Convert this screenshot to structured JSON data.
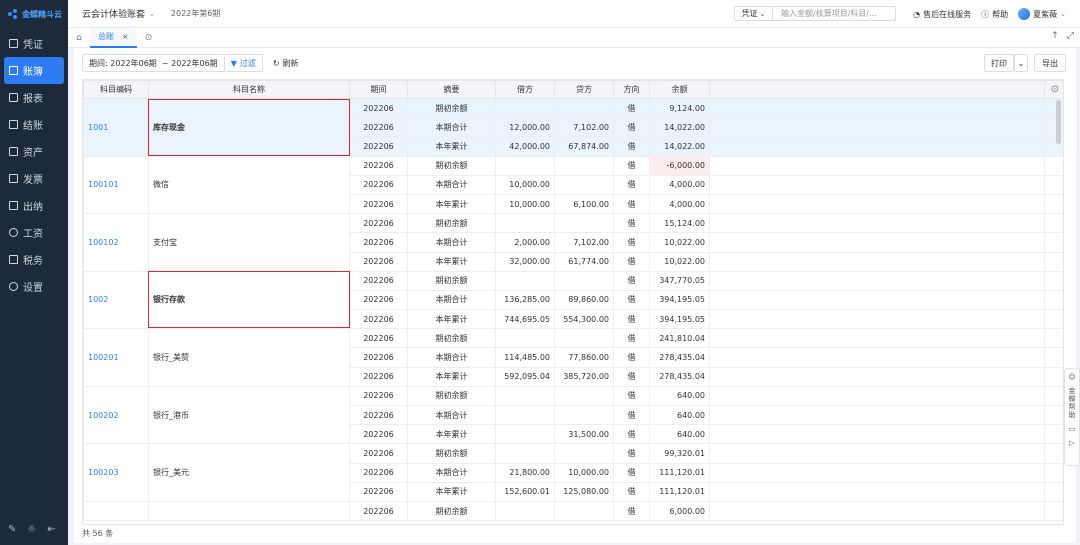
{
  "app": {
    "logo_text": "金蝶精斗云",
    "company": "云会计体验账套",
    "period": "2022年第6期"
  },
  "nav": [
    {
      "label": "凭证",
      "icon": "voucher-icon"
    },
    {
      "label": "账簿",
      "icon": "ledger-icon",
      "active": true
    },
    {
      "label": "报表",
      "icon": "report-icon"
    },
    {
      "label": "结账",
      "icon": "closing-icon"
    },
    {
      "label": "资产",
      "icon": "asset-icon"
    },
    {
      "label": "发票",
      "icon": "invoice-icon"
    },
    {
      "label": "出纳",
      "icon": "cashier-icon"
    },
    {
      "label": "工资",
      "icon": "salary-icon"
    },
    {
      "label": "税务",
      "icon": "tax-icon"
    },
    {
      "label": "设置",
      "icon": "settings-icon"
    }
  ],
  "top": {
    "voucher_select": "凭证",
    "search_placeholder": "输入金额/核算项目/科目/...",
    "service": "售后在线服务",
    "help": "帮助",
    "user": "夏紫薇"
  },
  "tabs": {
    "active": "总账"
  },
  "toolbar": {
    "period_label": "期间:",
    "period_start": "2022年06期",
    "period_sep": "~",
    "period_end": "2022年06期",
    "filter": "过滤",
    "refresh": "刷新",
    "print": "打印",
    "export": "导出"
  },
  "table": {
    "headers": [
      "科目编码",
      "科目名称",
      "期间",
      "摘要",
      "借方",
      "贷方",
      "方向",
      "余额"
    ],
    "groups": [
      {
        "code": "1001",
        "name": "库存现金",
        "bold": true,
        "highlight": true,
        "rows": [
          [
            "202206",
            "期初余额",
            "",
            "",
            "借",
            "9,124.00"
          ],
          [
            "202206",
            "本期合计",
            "12,000.00",
            "7,102.00",
            "借",
            "14,022.00"
          ],
          [
            "202206",
            "本年累计",
            "42,000.00",
            "67,874.00",
            "借",
            "14,022.00"
          ]
        ]
      },
      {
        "code": "100101",
        "name": "微信",
        "rows": [
          [
            "202206",
            "期初余额",
            "",
            "",
            "借",
            "-6,000.00"
          ],
          [
            "202206",
            "本期合计",
            "10,000.00",
            "",
            "借",
            "4,000.00"
          ],
          [
            "202206",
            "本年累计",
            "10,000.00",
            "6,100.00",
            "借",
            "4,000.00"
          ]
        ]
      },
      {
        "code": "100102",
        "name": "支付宝",
        "rows": [
          [
            "202206",
            "期初余额",
            "",
            "",
            "借",
            "15,124.00"
          ],
          [
            "202206",
            "本期合计",
            "2,000.00",
            "7,102.00",
            "借",
            "10,022.00"
          ],
          [
            "202206",
            "本年累计",
            "32,000.00",
            "61,774.00",
            "借",
            "10,022.00"
          ]
        ]
      },
      {
        "code": "1002",
        "name": "银行存款",
        "bold": true,
        "rows": [
          [
            "202206",
            "期初余额",
            "",
            "",
            "借",
            "347,770.05"
          ],
          [
            "202206",
            "本期合计",
            "136,285.00",
            "89,860.00",
            "借",
            "394,195.05"
          ],
          [
            "202206",
            "本年累计",
            "744,695.05",
            "554,300.00",
            "借",
            "394,195.05"
          ]
        ]
      },
      {
        "code": "100201",
        "name": "银行_美赞",
        "rows": [
          [
            "202206",
            "期初余额",
            "",
            "",
            "借",
            "241,810.04"
          ],
          [
            "202206",
            "本期合计",
            "114,485.00",
            "77,860.00",
            "借",
            "278,435.04"
          ],
          [
            "202206",
            "本年累计",
            "592,095.04",
            "385,720.00",
            "借",
            "278,435.04"
          ]
        ]
      },
      {
        "code": "100202",
        "name": "银行_港币",
        "rows": [
          [
            "202206",
            "期初余额",
            "",
            "",
            "借",
            "640.00"
          ],
          [
            "202206",
            "本期合计",
            "",
            "",
            "借",
            "640.00"
          ],
          [
            "202206",
            "本年累计",
            "",
            "31,500.00",
            "借",
            "640.00"
          ]
        ]
      },
      {
        "code": "100203",
        "name": "银行_美元",
        "rows": [
          [
            "202206",
            "期初余额",
            "",
            "",
            "借",
            "99,320.01"
          ],
          [
            "202206",
            "本期合计",
            "21,800.00",
            "10,000.00",
            "借",
            "111,120.01"
          ],
          [
            "202206",
            "本年累计",
            "152,600.01",
            "125,080.00",
            "借",
            "111,120.01"
          ]
        ]
      },
      {
        "code": "",
        "name": "",
        "rows": [
          [
            "202206",
            "期初余额",
            "",
            "",
            "借",
            "6,000.00"
          ]
        ]
      }
    ]
  },
  "footer": {
    "total": "共 56 条"
  },
  "float_helper": {
    "label": "金蝶帮助"
  },
  "colors": {
    "accent": "#2e7bf6",
    "sidebar": "#1d2a3c",
    "highlight_box": "#e0242e",
    "row_highlight": "#eaf4fc",
    "negative_bg": "#fdecec"
  }
}
